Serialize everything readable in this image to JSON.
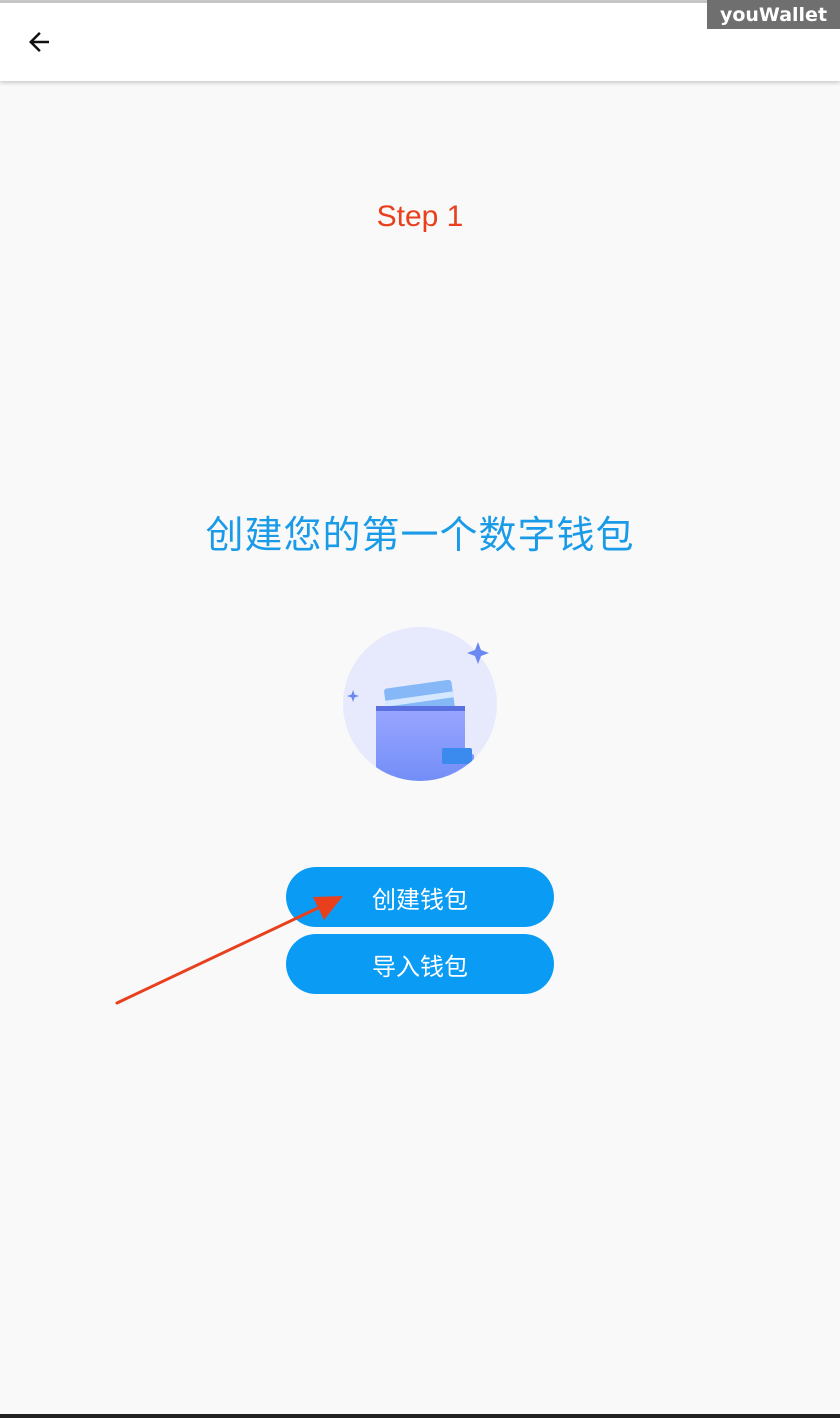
{
  "app": {
    "watermark": "youWallet"
  },
  "header": {
    "back_icon": "arrow-left-icon"
  },
  "step": {
    "label": "Step 1"
  },
  "main": {
    "headline": "创建您的第一个数字钱包",
    "illustration_icon": "wallet-icon"
  },
  "buttons": {
    "create_label": "创建钱包",
    "import_label": "导入钱包"
  },
  "colors": {
    "accent": "#0a9bf5",
    "headline": "#1a9be8",
    "step_annotation": "#e8401c"
  }
}
